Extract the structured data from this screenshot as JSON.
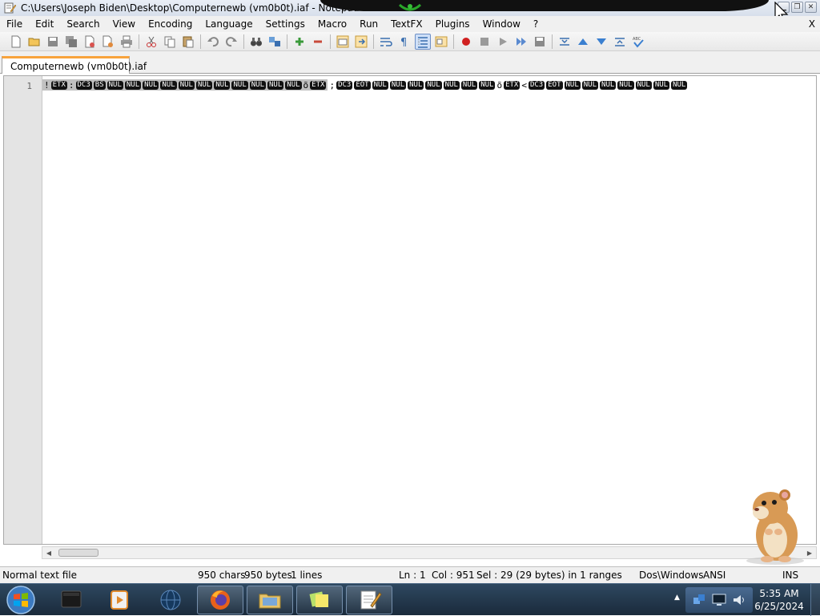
{
  "window": {
    "title": "C:\\Users\\Joseph Biden\\Desktop\\Computernewb (vm0b0t).iaf - Notepad"
  },
  "menu": {
    "items": [
      "File",
      "Edit",
      "Search",
      "View",
      "Encoding",
      "Language",
      "Settings",
      "Macro",
      "Run",
      "TextFX",
      "Plugins",
      "Window",
      "?"
    ],
    "close_label": "X"
  },
  "tab": {
    "label": "Computernewb (vm0b0t).iaf"
  },
  "editor": {
    "line_number": "1",
    "tokens": [
      {
        "t": "ch",
        "v": "!",
        "sel": true
      },
      {
        "t": "ctl",
        "v": "ETX",
        "sel": true
      },
      {
        "t": "ch",
        "v": ":",
        "sel": true
      },
      {
        "t": "ctl",
        "v": "DC3",
        "sel": true
      },
      {
        "t": "ctl",
        "v": "BS",
        "sel": true
      },
      {
        "t": "ctl",
        "v": "NUL",
        "sel": true
      },
      {
        "t": "ctl",
        "v": "NUL",
        "sel": true
      },
      {
        "t": "ctl",
        "v": "NUL",
        "sel": true
      },
      {
        "t": "ctl",
        "v": "NUL",
        "sel": true
      },
      {
        "t": "ctl",
        "v": "NUL",
        "sel": true
      },
      {
        "t": "ctl",
        "v": "NUL",
        "sel": true
      },
      {
        "t": "ctl",
        "v": "NUL",
        "sel": true
      },
      {
        "t": "ctl",
        "v": "NUL",
        "sel": true
      },
      {
        "t": "ctl",
        "v": "NUL",
        "sel": true
      },
      {
        "t": "ctl",
        "v": "NUL",
        "sel": true
      },
      {
        "t": "ctl",
        "v": "NUL",
        "sel": true
      },
      {
        "t": "ch",
        "v": "õ",
        "sel": true
      },
      {
        "t": "ctl",
        "v": "ETX",
        "sel": true
      },
      {
        "t": "ch",
        "v": ";",
        "sel": false
      },
      {
        "t": "ctl",
        "v": "DC3",
        "sel": false
      },
      {
        "t": "ctl",
        "v": "EOT",
        "sel": false
      },
      {
        "t": "ctl",
        "v": "NUL",
        "sel": false
      },
      {
        "t": "ctl",
        "v": "NUL",
        "sel": false
      },
      {
        "t": "ctl",
        "v": "NUL",
        "sel": false
      },
      {
        "t": "ctl",
        "v": "NUL",
        "sel": false
      },
      {
        "t": "ctl",
        "v": "NUL",
        "sel": false
      },
      {
        "t": "ctl",
        "v": "NUL",
        "sel": false
      },
      {
        "t": "ctl",
        "v": "NUL",
        "sel": false
      },
      {
        "t": "ch",
        "v": "õ",
        "sel": false
      },
      {
        "t": "ctl",
        "v": "ETX",
        "sel": false
      },
      {
        "t": "ch",
        "v": "<",
        "sel": false
      },
      {
        "t": "ctl",
        "v": "DC3",
        "sel": false
      },
      {
        "t": "ctl",
        "v": "EOT",
        "sel": false
      },
      {
        "t": "ctl",
        "v": "NUL",
        "sel": false
      },
      {
        "t": "ctl",
        "v": "NUL",
        "sel": false
      },
      {
        "t": "ctl",
        "v": "NUL",
        "sel": false
      },
      {
        "t": "ctl",
        "v": "NUL",
        "sel": false
      },
      {
        "t": "ctl",
        "v": "NUL",
        "sel": false
      },
      {
        "t": "ctl",
        "v": "NUL",
        "sel": false
      },
      {
        "t": "ctl",
        "v": "NUL",
        "sel": false
      }
    ]
  },
  "status": {
    "file_type": "Normal text file",
    "chars": "950 chars",
    "bytes": "950 bytes",
    "lines": "1 lines",
    "ln": "Ln : 1",
    "col": "Col : 951",
    "sel": "Sel : 29 (29 bytes) in 1 ranges",
    "eol": "Dos\\Windows",
    "encoding": "ANSI",
    "mode": "INS"
  },
  "taskbar": {
    "time": "5:35 AM",
    "date": "6/25/2024"
  },
  "colors": {
    "tab_accent": "#f8a33c",
    "selection_bg": "#c0c0c0",
    "control_char_bg": "#111111",
    "taskbar_bg": "#1f3347"
  }
}
